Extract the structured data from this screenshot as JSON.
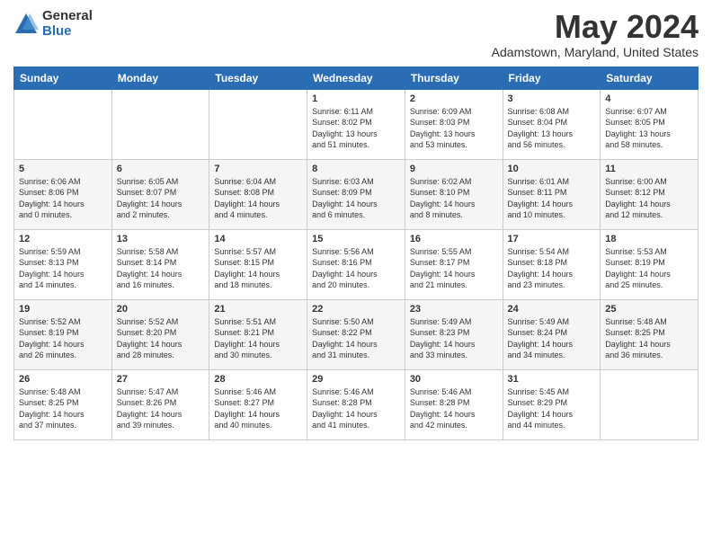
{
  "logo": {
    "general": "General",
    "blue": "Blue"
  },
  "title": "May 2024",
  "location": "Adamstown, Maryland, United States",
  "days_of_week": [
    "Sunday",
    "Monday",
    "Tuesday",
    "Wednesday",
    "Thursday",
    "Friday",
    "Saturday"
  ],
  "weeks": [
    [
      {
        "num": "",
        "info": ""
      },
      {
        "num": "",
        "info": ""
      },
      {
        "num": "",
        "info": ""
      },
      {
        "num": "1",
        "info": "Sunrise: 6:11 AM\nSunset: 8:02 PM\nDaylight: 13 hours\nand 51 minutes."
      },
      {
        "num": "2",
        "info": "Sunrise: 6:09 AM\nSunset: 8:03 PM\nDaylight: 13 hours\nand 53 minutes."
      },
      {
        "num": "3",
        "info": "Sunrise: 6:08 AM\nSunset: 8:04 PM\nDaylight: 13 hours\nand 56 minutes."
      },
      {
        "num": "4",
        "info": "Sunrise: 6:07 AM\nSunset: 8:05 PM\nDaylight: 13 hours\nand 58 minutes."
      }
    ],
    [
      {
        "num": "5",
        "info": "Sunrise: 6:06 AM\nSunset: 8:06 PM\nDaylight: 14 hours\nand 0 minutes."
      },
      {
        "num": "6",
        "info": "Sunrise: 6:05 AM\nSunset: 8:07 PM\nDaylight: 14 hours\nand 2 minutes."
      },
      {
        "num": "7",
        "info": "Sunrise: 6:04 AM\nSunset: 8:08 PM\nDaylight: 14 hours\nand 4 minutes."
      },
      {
        "num": "8",
        "info": "Sunrise: 6:03 AM\nSunset: 8:09 PM\nDaylight: 14 hours\nand 6 minutes."
      },
      {
        "num": "9",
        "info": "Sunrise: 6:02 AM\nSunset: 8:10 PM\nDaylight: 14 hours\nand 8 minutes."
      },
      {
        "num": "10",
        "info": "Sunrise: 6:01 AM\nSunset: 8:11 PM\nDaylight: 14 hours\nand 10 minutes."
      },
      {
        "num": "11",
        "info": "Sunrise: 6:00 AM\nSunset: 8:12 PM\nDaylight: 14 hours\nand 12 minutes."
      }
    ],
    [
      {
        "num": "12",
        "info": "Sunrise: 5:59 AM\nSunset: 8:13 PM\nDaylight: 14 hours\nand 14 minutes."
      },
      {
        "num": "13",
        "info": "Sunrise: 5:58 AM\nSunset: 8:14 PM\nDaylight: 14 hours\nand 16 minutes."
      },
      {
        "num": "14",
        "info": "Sunrise: 5:57 AM\nSunset: 8:15 PM\nDaylight: 14 hours\nand 18 minutes."
      },
      {
        "num": "15",
        "info": "Sunrise: 5:56 AM\nSunset: 8:16 PM\nDaylight: 14 hours\nand 20 minutes."
      },
      {
        "num": "16",
        "info": "Sunrise: 5:55 AM\nSunset: 8:17 PM\nDaylight: 14 hours\nand 21 minutes."
      },
      {
        "num": "17",
        "info": "Sunrise: 5:54 AM\nSunset: 8:18 PM\nDaylight: 14 hours\nand 23 minutes."
      },
      {
        "num": "18",
        "info": "Sunrise: 5:53 AM\nSunset: 8:19 PM\nDaylight: 14 hours\nand 25 minutes."
      }
    ],
    [
      {
        "num": "19",
        "info": "Sunrise: 5:52 AM\nSunset: 8:19 PM\nDaylight: 14 hours\nand 26 minutes."
      },
      {
        "num": "20",
        "info": "Sunrise: 5:52 AM\nSunset: 8:20 PM\nDaylight: 14 hours\nand 28 minutes."
      },
      {
        "num": "21",
        "info": "Sunrise: 5:51 AM\nSunset: 8:21 PM\nDaylight: 14 hours\nand 30 minutes."
      },
      {
        "num": "22",
        "info": "Sunrise: 5:50 AM\nSunset: 8:22 PM\nDaylight: 14 hours\nand 31 minutes."
      },
      {
        "num": "23",
        "info": "Sunrise: 5:49 AM\nSunset: 8:23 PM\nDaylight: 14 hours\nand 33 minutes."
      },
      {
        "num": "24",
        "info": "Sunrise: 5:49 AM\nSunset: 8:24 PM\nDaylight: 14 hours\nand 34 minutes."
      },
      {
        "num": "25",
        "info": "Sunrise: 5:48 AM\nSunset: 8:25 PM\nDaylight: 14 hours\nand 36 minutes."
      }
    ],
    [
      {
        "num": "26",
        "info": "Sunrise: 5:48 AM\nSunset: 8:25 PM\nDaylight: 14 hours\nand 37 minutes."
      },
      {
        "num": "27",
        "info": "Sunrise: 5:47 AM\nSunset: 8:26 PM\nDaylight: 14 hours\nand 39 minutes."
      },
      {
        "num": "28",
        "info": "Sunrise: 5:46 AM\nSunset: 8:27 PM\nDaylight: 14 hours\nand 40 minutes."
      },
      {
        "num": "29",
        "info": "Sunrise: 5:46 AM\nSunset: 8:28 PM\nDaylight: 14 hours\nand 41 minutes."
      },
      {
        "num": "30",
        "info": "Sunrise: 5:46 AM\nSunset: 8:28 PM\nDaylight: 14 hours\nand 42 minutes."
      },
      {
        "num": "31",
        "info": "Sunrise: 5:45 AM\nSunset: 8:29 PM\nDaylight: 14 hours\nand 44 minutes."
      },
      {
        "num": "",
        "info": ""
      }
    ]
  ]
}
